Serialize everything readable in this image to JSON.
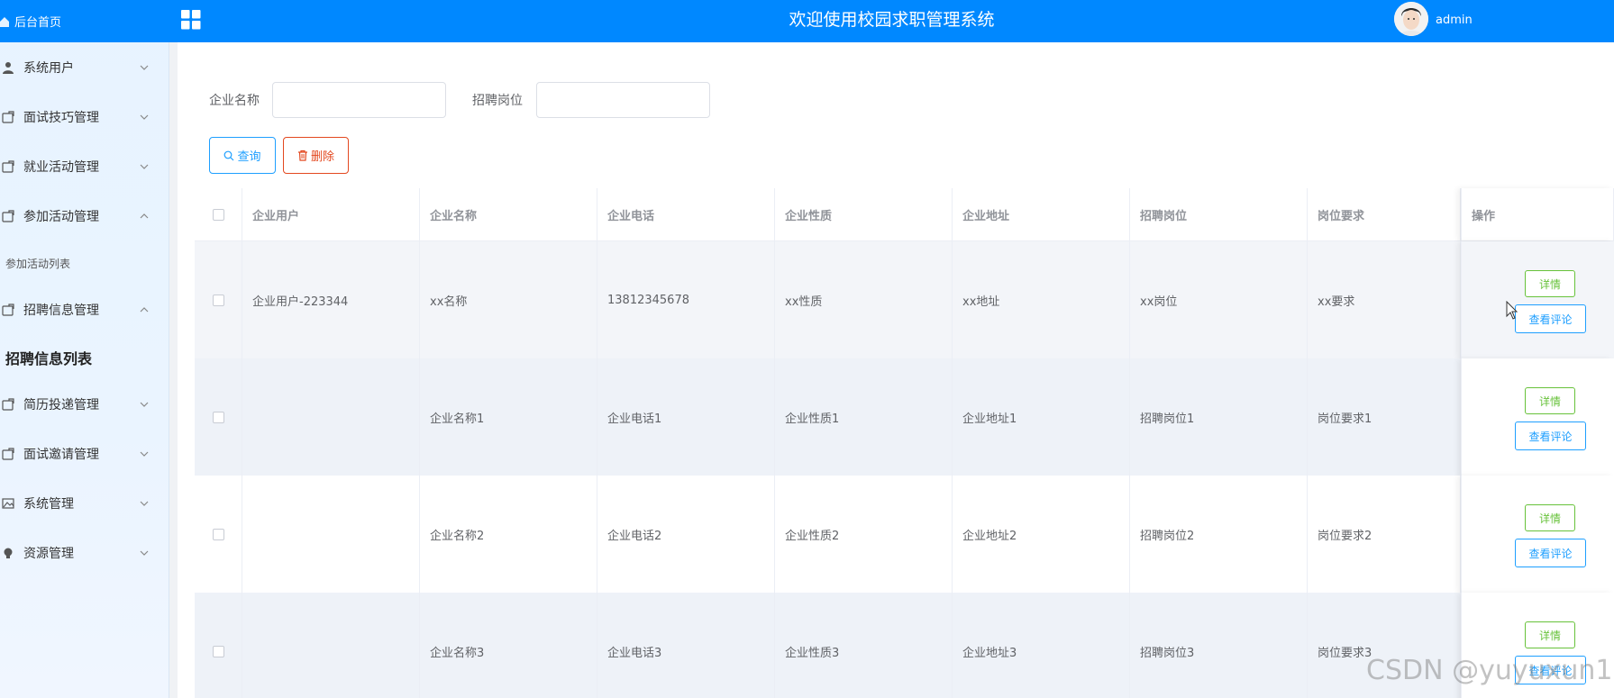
{
  "header": {
    "title": "欢迎使用校园求职管理系统",
    "username": "admin",
    "brand_color": "#0088ff"
  },
  "sidebar": {
    "home_label": "后台首页",
    "items": [
      {
        "label": "系统用户",
        "icon": "user-icon",
        "expanded": false
      },
      {
        "label": "面试技巧管理",
        "icon": "folder-icon",
        "expanded": false
      },
      {
        "label": "就业活动管理",
        "icon": "folder-icon",
        "expanded": false
      },
      {
        "label": "参加活动管理",
        "icon": "folder-icon",
        "expanded": true,
        "children": [
          "参加活动列表"
        ]
      },
      {
        "label": "招聘信息管理",
        "icon": "folder-icon",
        "expanded": true,
        "children": [
          "招聘信息列表"
        ]
      },
      {
        "label": "简历投递管理",
        "icon": "folder-icon",
        "expanded": false
      },
      {
        "label": "面试邀请管理",
        "icon": "folder-icon",
        "expanded": false
      },
      {
        "label": "系统管理",
        "icon": "image-icon",
        "expanded": false
      },
      {
        "label": "资源管理",
        "icon": "bulb-icon",
        "expanded": false
      }
    ]
  },
  "search": {
    "company_label": "企业名称",
    "company_value": "",
    "position_label": "招聘岗位",
    "position_value": "",
    "query_button": "查询",
    "delete_button": "删除"
  },
  "table": {
    "columns": [
      "企业用户",
      "企业名称",
      "企业电话",
      "企业性质",
      "企业地址",
      "招聘岗位",
      "岗位要求",
      "操作"
    ],
    "rows": [
      [
        "企业用户-223344",
        "xx名称",
        "13812345678",
        "xx性质",
        "xx地址",
        "xx岗位",
        "xx要求"
      ],
      [
        "",
        "企业名称1",
        "企业电话1",
        "企业性质1",
        "企业地址1",
        "招聘岗位1",
        "岗位要求1"
      ],
      [
        "",
        "企业名称2",
        "企业电话2",
        "企业性质2",
        "企业地址2",
        "招聘岗位2",
        "岗位要求2"
      ],
      [
        "",
        "企业名称3",
        "企业电话3",
        "企业性质3",
        "企业地址3",
        "招聘岗位3",
        "岗位要求3"
      ]
    ],
    "detail_button": "详情",
    "review_button": "查看评论"
  },
  "watermark": "CSDN @yuyuxun1"
}
